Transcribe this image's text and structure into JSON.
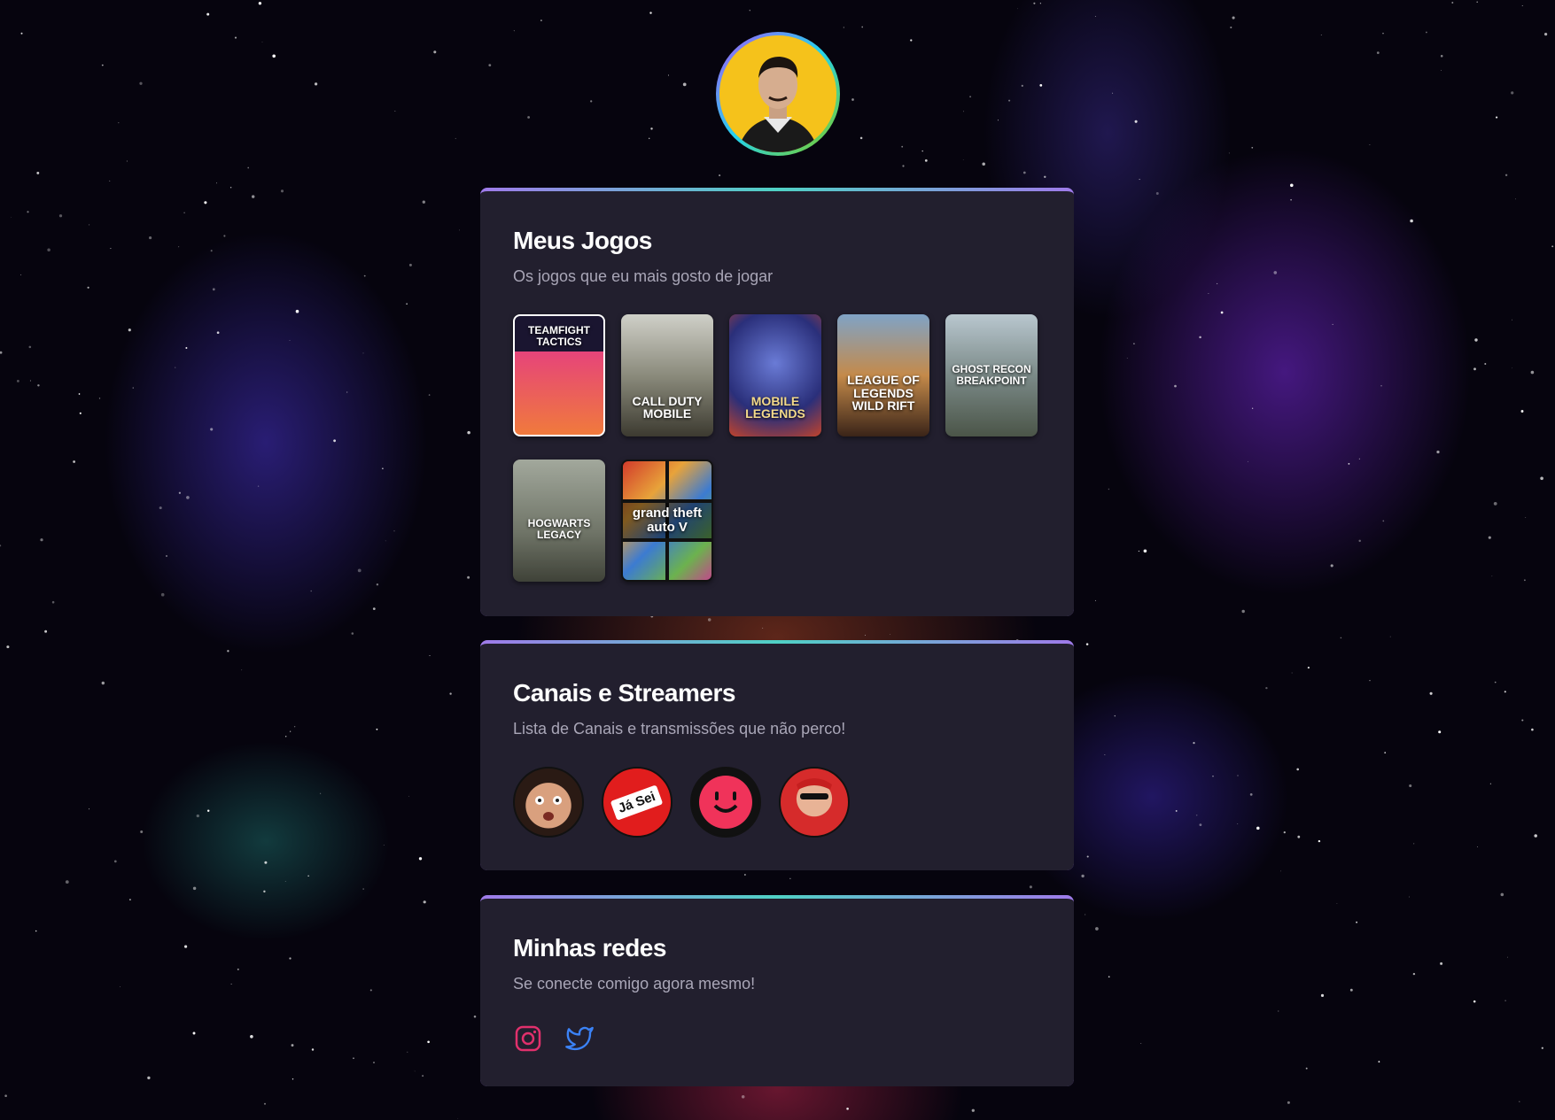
{
  "profile": {
    "avatar_alt": "avatar"
  },
  "games_section": {
    "title": "Meus Jogos",
    "subtitle": "Os jogos que eu mais gosto de jogar",
    "games": [
      {
        "label": "TEAMFIGHT TACTICS",
        "name": "game-teamfight-tactics"
      },
      {
        "label": "CALL DUTY MOBILE",
        "name": "game-call-of-duty-mobile"
      },
      {
        "label": "MOBILE LEGENDS",
        "name": "game-mobile-legends"
      },
      {
        "label": "LEAGUE OF LEGENDS WILD RIFT",
        "name": "game-wild-rift"
      },
      {
        "label": "GHOST RECON BREAKPOINT",
        "name": "game-ghost-recon"
      },
      {
        "label": "HOGWARTS LEGACY",
        "name": "game-hogwarts-legacy"
      },
      {
        "label": "grand theft auto V",
        "name": "game-gta-v"
      }
    ]
  },
  "channels_section": {
    "title": "Canais e Streamers",
    "subtitle": "Lista de Canais e transmissões que não perco!",
    "channels": [
      {
        "name": "channel-1"
      },
      {
        "label": "Já Sei",
        "name": "channel-ja-sei"
      },
      {
        "name": "channel-3"
      },
      {
        "name": "channel-4"
      }
    ]
  },
  "social_section": {
    "title": "Minhas redes",
    "subtitle": "Se conecte comigo agora mesmo!",
    "links": [
      {
        "icon": "instagram-icon",
        "color": "#e1306c"
      },
      {
        "icon": "twitter-icon",
        "color": "#3b82f6"
      }
    ]
  }
}
